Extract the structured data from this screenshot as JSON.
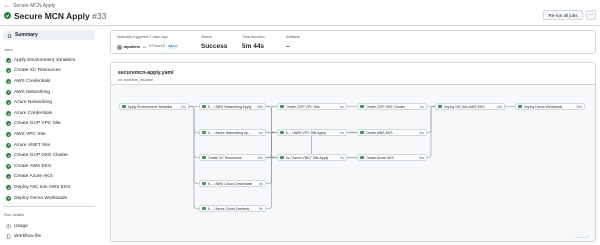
{
  "breadcrumb": {
    "label": "Secure MCN Apply"
  },
  "header": {
    "title": "Secure MCN Apply",
    "run_number": "#33",
    "rerun_label": "Re-run all jobs",
    "more_label": "···"
  },
  "sidebar": {
    "summary_label": "Summary",
    "jobs_heading": "Jobs",
    "jobs": [
      "Apply Environment Variables",
      "Create XC Resources",
      "AWS Credentials",
      "AWS Networking",
      "Azure Networking",
      "Azure Credentials",
      "Create GCP VPC Site",
      "AWS VPC Site",
      "Azure VNET Site",
      "Create GCP GKE Cluster",
      "Create AWS EKS",
      "Create Azure AKS",
      "Deploy NIC into AWS EKS",
      "Deploy Demo Workloads"
    ],
    "details_heading": "Run details",
    "details": [
      {
        "label": "Usage",
        "icon": "clock-icon"
      },
      {
        "label": "Workflow file",
        "icon": "file-icon"
      }
    ]
  },
  "summary": {
    "trigger_caption": "Manually triggered 2 days ago",
    "actor": "drpotters",
    "commit_sha": "5f4ed48",
    "branch": "main",
    "status_label": "Status",
    "status_value": "Success",
    "duration_label": "Total duration",
    "duration_value": "5m 44s",
    "artifacts_label": "Artifacts",
    "artifacts_value": "–"
  },
  "graph": {
    "file": "securemcn-apply.yaml",
    "trigger": "on: workflow_dispatch",
    "nodes": [
      {
        "name": "Apply Environment Variables",
        "time": "11s"
      },
      {
        "name": "A... / AWS Networking Apply",
        "time": "59s"
      },
      {
        "name": "A... / Azure Networking Ap...",
        "time": "1m"
      },
      {
        "name": "Create XC Resources",
        "time": "16s"
      },
      {
        "name": "A... / AWS Cloud Credentials",
        "time": "8s"
      },
      {
        "name": "A... / Azure Cloud Credenti...",
        "time": "8s"
      },
      {
        "name": "Create GCP VPC Site",
        "time": "1m"
      },
      {
        "name": "A... / AWS VPC Site Apply",
        "time": "9s"
      },
      {
        "name": "Az / Azure VNET Site Apply",
        "time": "9s"
      },
      {
        "name": "Create GCP GKE Cluster",
        "time": "1m"
      },
      {
        "name": "Create AWS EKS",
        "time": "4m"
      },
      {
        "name": "Create Azure AKS",
        "time": "5m"
      },
      {
        "name": "Deploy NIC into AWS EKS",
        "time": "19s"
      },
      {
        "name": "Deploy Demo Workloads",
        "time": "30s"
      }
    ],
    "zoom_label": "—  ——  +"
  },
  "colors": {
    "success": "#1f883d",
    "border": "#d1d9e0",
    "muted": "#59636e"
  }
}
